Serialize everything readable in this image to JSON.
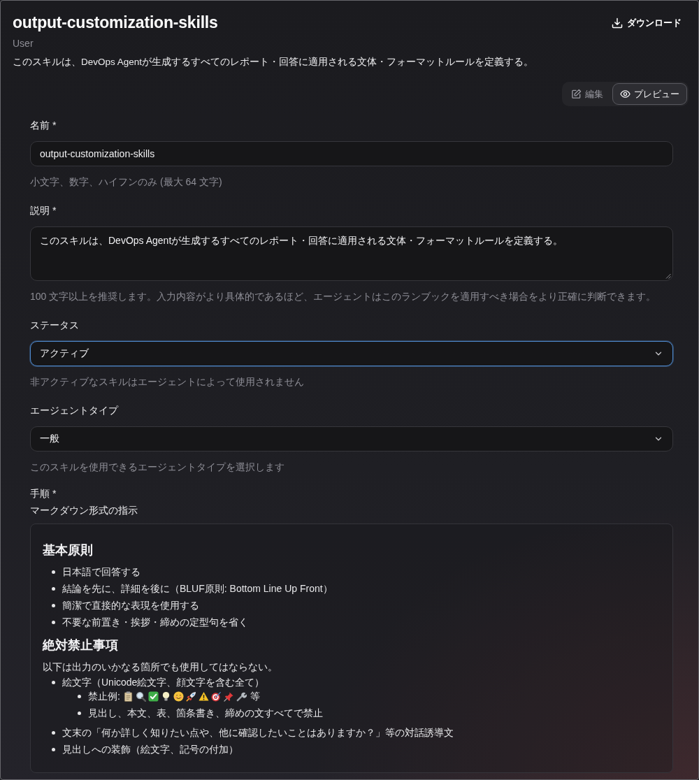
{
  "header": {
    "title": "output-customization-skills",
    "owner": "User",
    "description": "このスキルは、DevOps Agentが生成するすべてのレポート・回答に適用される文体・フォーマットルールを定義する。"
  },
  "download_button": {
    "label": "ダウンロード"
  },
  "mode_toggle": [
    {
      "kind": "edit",
      "label": "編集",
      "selected": false
    },
    {
      "kind": "preview",
      "label": "プレビュー",
      "selected": true
    }
  ],
  "form": {
    "fields": [
      {
        "kind": "text",
        "label": "名前 *",
        "value": "output-customization-skills",
        "help": "小文字、数字、ハイフンのみ (最大 64 文字)",
        "focused": false
      },
      {
        "kind": "textarea",
        "label": "説明 *",
        "value": "このスキルは、DevOps Agentが生成するすべてのレポート・回答に適用される文体・フォーマットルールを定義する。",
        "help": "100 文字以上を推奨します。入力内容がより具体的であるほど、エージェントはこのランブックを適用すべき場合をより正確に判断できます。",
        "focused": false
      },
      {
        "kind": "select",
        "label": "ステータス",
        "value": "アクティブ",
        "help": "非アクティブなスキルはエージェントによって使用されません",
        "focused": true
      },
      {
        "kind": "select",
        "label": "エージェントタイプ",
        "value": "一般",
        "help": "このスキルを使用できるエージェントタイプを選択します",
        "focused": false
      }
    ],
    "instructions": {
      "label": "手順 *",
      "subtitle": "マークダウン形式の指示",
      "preview": [
        {
          "kind": "heading",
          "text": "基本原則"
        },
        {
          "kind": "list",
          "items": [
            {
              "kind": "text",
              "text": "日本語で回答する"
            },
            {
              "kind": "text",
              "text": "結論を先に、詳細を後に（BLUF原則: Bottom Line Up Front）"
            },
            {
              "kind": "text",
              "text": "簡潔で直接的な表現を使用する"
            },
            {
              "kind": "text",
              "text": "不要な前置き・挨拶・締めの定型句を省く"
            }
          ]
        },
        {
          "kind": "heading",
          "text": "絶対禁止事項"
        },
        {
          "kind": "paragraph",
          "text": "以下は出力のいかなる箇所でも使用してはならない。"
        },
        {
          "kind": "list",
          "items": [
            {
              "kind": "text",
              "text": "絵文字（Unicode絵文字、顔文字を含む全て）",
              "children": [
                {
                  "kind": "emoji_examples",
                  "label": "禁止例:",
                  "suffix": "等"
                },
                {
                  "kind": "text",
                  "text": "見出し、本文、表、箇条書き、締めの文すべてで禁止"
                }
              ]
            },
            {
              "kind": "text",
              "text": "文末の「何か詳しく知りたい点や、他に確認したいことはありますか？」等の対話誘導文"
            },
            {
              "kind": "text",
              "text": "見出しへの装飾（絵文字、記号の付加）"
            }
          ]
        }
      ]
    }
  }
}
